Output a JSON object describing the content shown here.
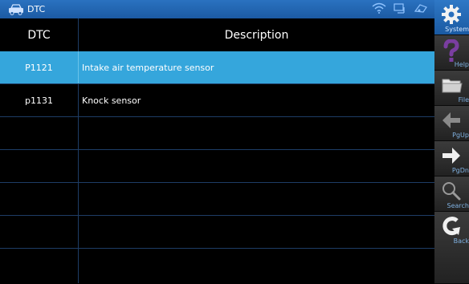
{
  "window": {
    "title": "DTC"
  },
  "table": {
    "headers": {
      "code": "DTC",
      "description": "Description"
    },
    "rows": [
      {
        "code": "P1121",
        "description": "Intake air temperature sensor",
        "selected": true
      },
      {
        "code": "p1131",
        "description": "Knock sensor",
        "selected": false
      },
      {
        "code": "",
        "description": ""
      },
      {
        "code": "",
        "description": ""
      },
      {
        "code": "",
        "description": ""
      },
      {
        "code": "",
        "description": ""
      },
      {
        "code": "",
        "description": ""
      }
    ]
  },
  "sidebar": {
    "buttons": [
      {
        "label": "System",
        "icon": "gear-icon"
      },
      {
        "label": "Help",
        "icon": "question-icon"
      },
      {
        "label": "File",
        "icon": "folder-icon"
      },
      {
        "label": "PgUp",
        "icon": "arrow-left-icon"
      },
      {
        "label": "PgDn",
        "icon": "arrow-right-icon"
      },
      {
        "label": "Search",
        "icon": "magnifier-icon"
      },
      {
        "label": "Back",
        "icon": "back-icon"
      }
    ]
  },
  "colors": {
    "titlebar": "#1c5aa3",
    "selected_row": "#35a6dc",
    "grid": "#1e3d66"
  }
}
